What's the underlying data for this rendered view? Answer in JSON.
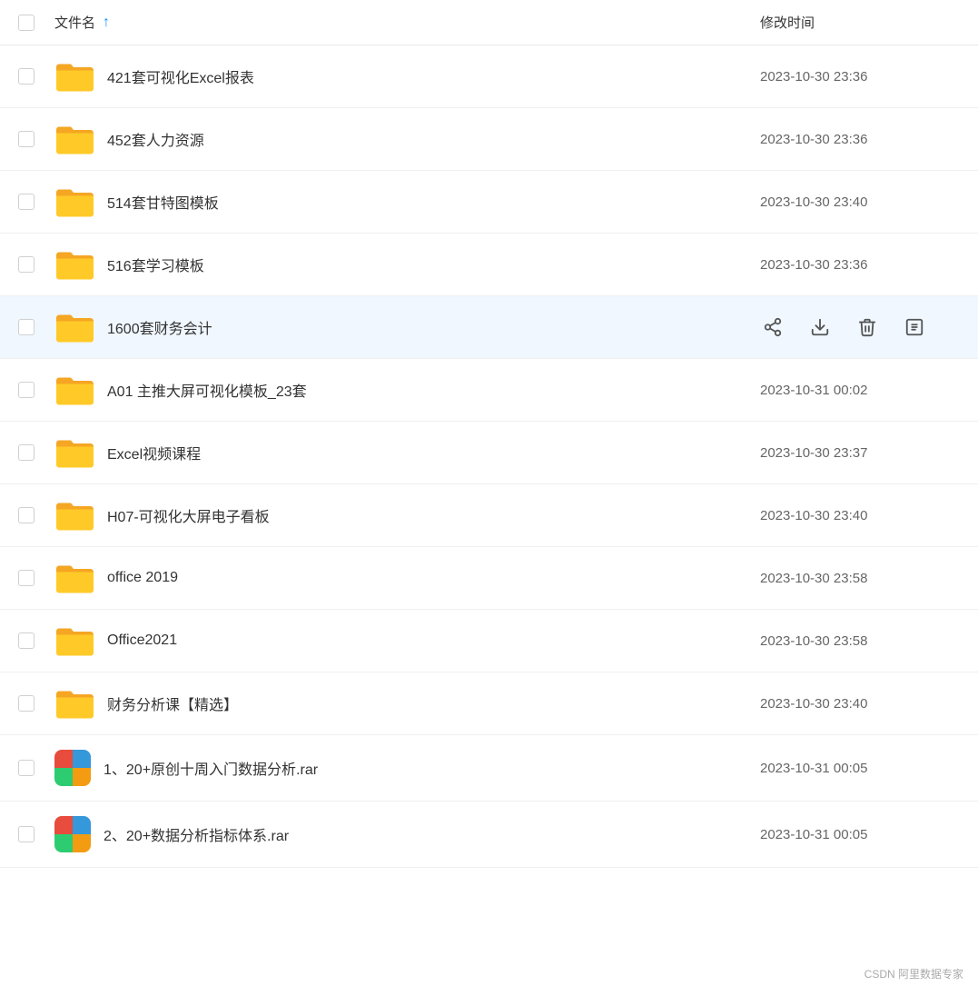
{
  "header": {
    "filename_label": "文件名",
    "date_label": "修改时间",
    "sort_icon": "↑"
  },
  "files": [
    {
      "id": 1,
      "name": "421套可视化Excel报表",
      "type": "folder",
      "date": "2023-10-30 23:36",
      "highlighted": false,
      "showActions": false
    },
    {
      "id": 2,
      "name": "452套人力资源",
      "type": "folder",
      "date": "2023-10-30 23:36",
      "highlighted": false,
      "showActions": false
    },
    {
      "id": 3,
      "name": "514套甘特图模板",
      "type": "folder",
      "date": "2023-10-30 23:40",
      "highlighted": false,
      "showActions": false
    },
    {
      "id": 4,
      "name": "516套学习模板",
      "type": "folder",
      "date": "2023-10-30 23:36",
      "highlighted": false,
      "showActions": false
    },
    {
      "id": 5,
      "name": "1600套财务会计",
      "type": "folder",
      "date": "",
      "highlighted": true,
      "showActions": true
    },
    {
      "id": 6,
      "name": "A01 主推大屏可视化模板_23套",
      "type": "folder",
      "date": "2023-10-31 00:02",
      "highlighted": false,
      "showActions": false
    },
    {
      "id": 7,
      "name": "Excel视频课程",
      "type": "folder",
      "date": "2023-10-30 23:37",
      "highlighted": false,
      "showActions": false
    },
    {
      "id": 8,
      "name": "H07-可视化大屏电子看板",
      "type": "folder",
      "date": "2023-10-30 23:40",
      "highlighted": false,
      "showActions": false
    },
    {
      "id": 9,
      "name": "office 2019",
      "type": "folder",
      "date": "2023-10-30 23:58",
      "highlighted": false,
      "showActions": false
    },
    {
      "id": 10,
      "name": "Office2021",
      "type": "folder",
      "date": "2023-10-30 23:58",
      "highlighted": false,
      "showActions": false
    },
    {
      "id": 11,
      "name": "财务分析课【精选】",
      "type": "folder",
      "date": "2023-10-30 23:40",
      "highlighted": false,
      "showActions": false
    },
    {
      "id": 12,
      "name": "1、20+原创十周入门数据分析.rar",
      "type": "rar",
      "date": "2023-10-31 00:05",
      "highlighted": false,
      "showActions": false
    },
    {
      "id": 13,
      "name": "2、20+数据分析指标体系.rar",
      "type": "rar",
      "date": "2023-10-31 00:05",
      "highlighted": false,
      "showActions": false
    }
  ],
  "actions": {
    "share": "⋲",
    "download": "⬇",
    "delete": "🗑",
    "info": "ℹ"
  },
  "watermark": "CSDN 阿里数据专家"
}
